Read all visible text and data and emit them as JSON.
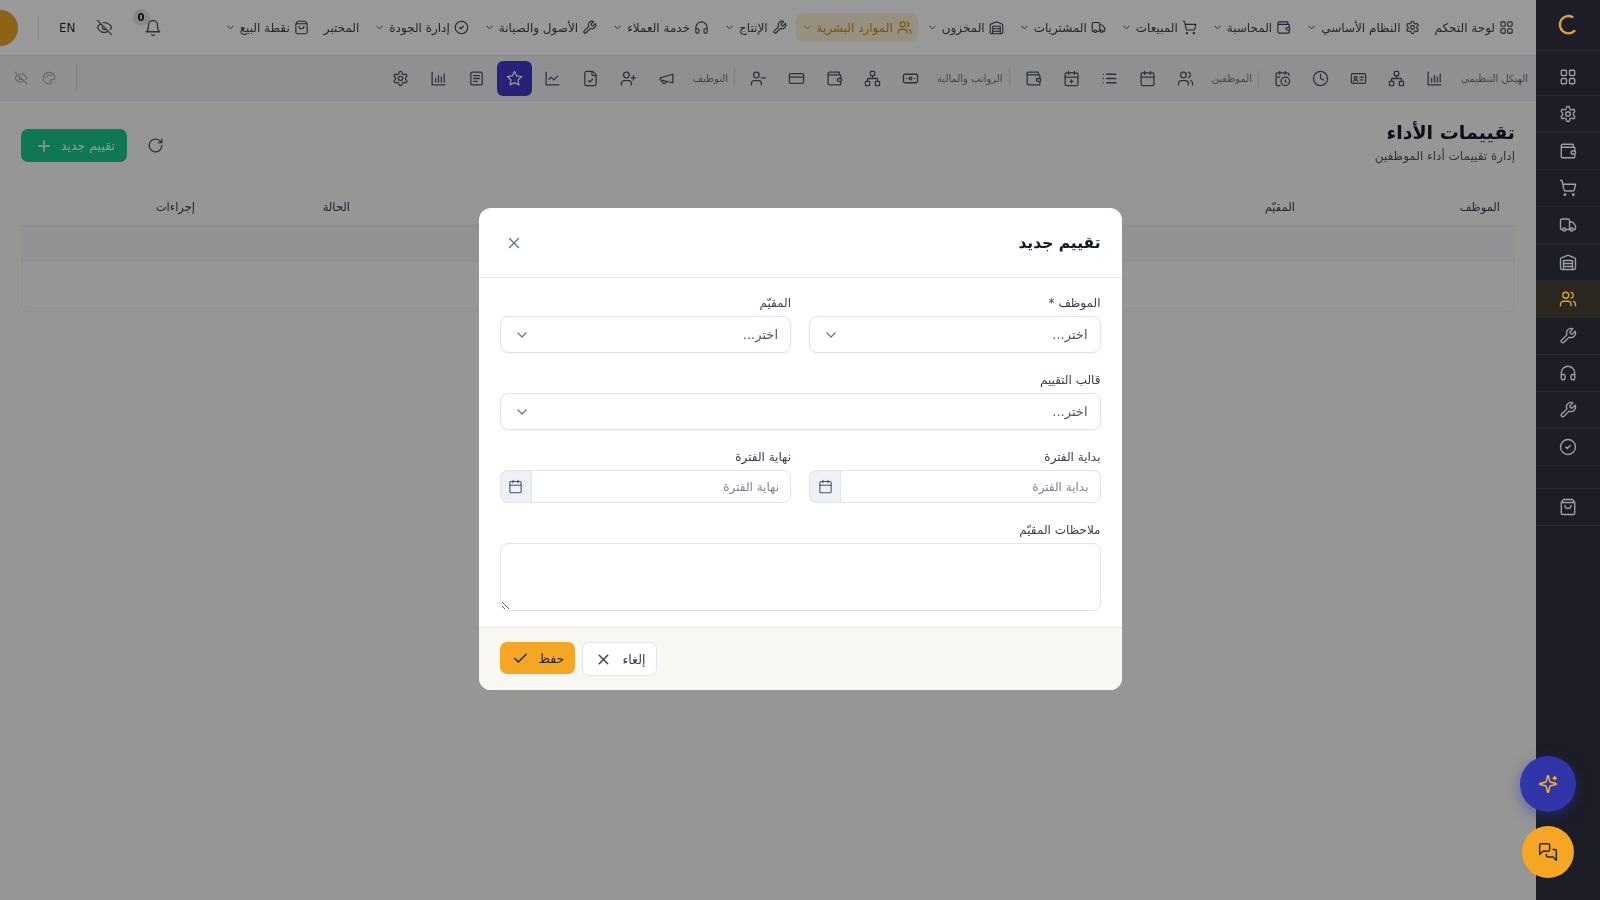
{
  "sidebar": {
    "items": [
      {
        "selected": false
      },
      {
        "selected": false
      },
      {
        "selected": false
      },
      {
        "selected": false
      },
      {
        "selected": false
      },
      {
        "selected": false
      },
      {
        "selected": true
      },
      {
        "selected": false
      },
      {
        "selected": false
      },
      {
        "selected": false
      },
      {
        "selected": false
      },
      {
        "selected": false
      }
    ]
  },
  "top_nav": {
    "items": [
      {
        "label": "لوحة التحكم",
        "dropdown": false,
        "selected": false
      },
      {
        "label": "النظام الأساسي",
        "dropdown": true,
        "selected": false
      },
      {
        "label": "المحاسبة",
        "dropdown": true,
        "selected": false
      },
      {
        "label": "المبيعات",
        "dropdown": true,
        "selected": false
      },
      {
        "label": "المشتريات",
        "dropdown": true,
        "selected": false
      },
      {
        "label": "المخزون",
        "dropdown": true,
        "selected": false
      },
      {
        "label": "الموارد البشرية",
        "dropdown": true,
        "selected": true
      },
      {
        "label": "الإنتاج",
        "dropdown": true,
        "selected": false
      },
      {
        "label": "خدمة العملاء",
        "dropdown": true,
        "selected": false
      },
      {
        "label": "الأصول والصيانة",
        "dropdown": true,
        "selected": false
      },
      {
        "label": "إدارة الجودة",
        "dropdown": true,
        "selected": false
      },
      {
        "label": "المختبر",
        "dropdown": false,
        "selected": false
      },
      {
        "label": "نقطة البيع",
        "dropdown": true,
        "selected": false
      }
    ],
    "notifications": {
      "count": "0"
    },
    "language": "EN"
  },
  "toolbar": {
    "groups": [
      {
        "label": "الهيكل التنظيمي",
        "items": [
          {
            "selected": false
          },
          {
            "selected": false
          },
          {
            "selected": false
          },
          {
            "selected": false
          },
          {
            "selected": false
          }
        ]
      },
      {
        "label": "الموظفين",
        "items": [
          {
            "selected": false
          },
          {
            "selected": false
          },
          {
            "selected": false
          },
          {
            "selected": false
          },
          {
            "selected": false
          }
        ]
      },
      {
        "label": "الرواتب والمالية",
        "items": [
          {
            "selected": false
          },
          {
            "selected": false
          },
          {
            "selected": false
          },
          {
            "selected": false
          },
          {
            "selected": false
          }
        ]
      },
      {
        "label": "التوظيف",
        "items": [
          {
            "selected": false
          },
          {
            "selected": false
          },
          {
            "selected": false
          },
          {
            "selected": false
          },
          {
            "selected": true
          },
          {
            "selected": false
          },
          {
            "selected": false
          },
          {
            "selected": false
          }
        ]
      }
    ]
  },
  "page": {
    "title": "تقييمات الأداء",
    "subtitle": "إدارة تقييمات أداء الموظفين",
    "new_button": "تقييم جديد"
  },
  "table": {
    "columns": [
      "الموظف",
      "المقيّم",
      "الحالة",
      "إجراءات"
    ]
  },
  "modal": {
    "title": "تقييم جديد",
    "rows": [
      [
        {
          "kind": "select",
          "label": "الموظف *",
          "placeholder": "اختر..."
        },
        {
          "kind": "select",
          "label": "المقيّم",
          "placeholder": "اختر..."
        }
      ],
      [
        {
          "kind": "select",
          "label": "قالب التقييم",
          "placeholder": "اختر..."
        }
      ],
      [
        {
          "kind": "date",
          "label": "بداية الفترة",
          "placeholder": "بداية الفترة"
        },
        {
          "kind": "date",
          "label": "نهاية الفترة",
          "placeholder": "نهاية الفترة"
        }
      ],
      [
        {
          "kind": "textarea",
          "label": "ملاحظات المقيّم"
        }
      ]
    ],
    "buttons": [
      {
        "kind": "secondary",
        "label": "إلغاء"
      },
      {
        "kind": "primary",
        "label": "حفظ"
      }
    ]
  }
}
